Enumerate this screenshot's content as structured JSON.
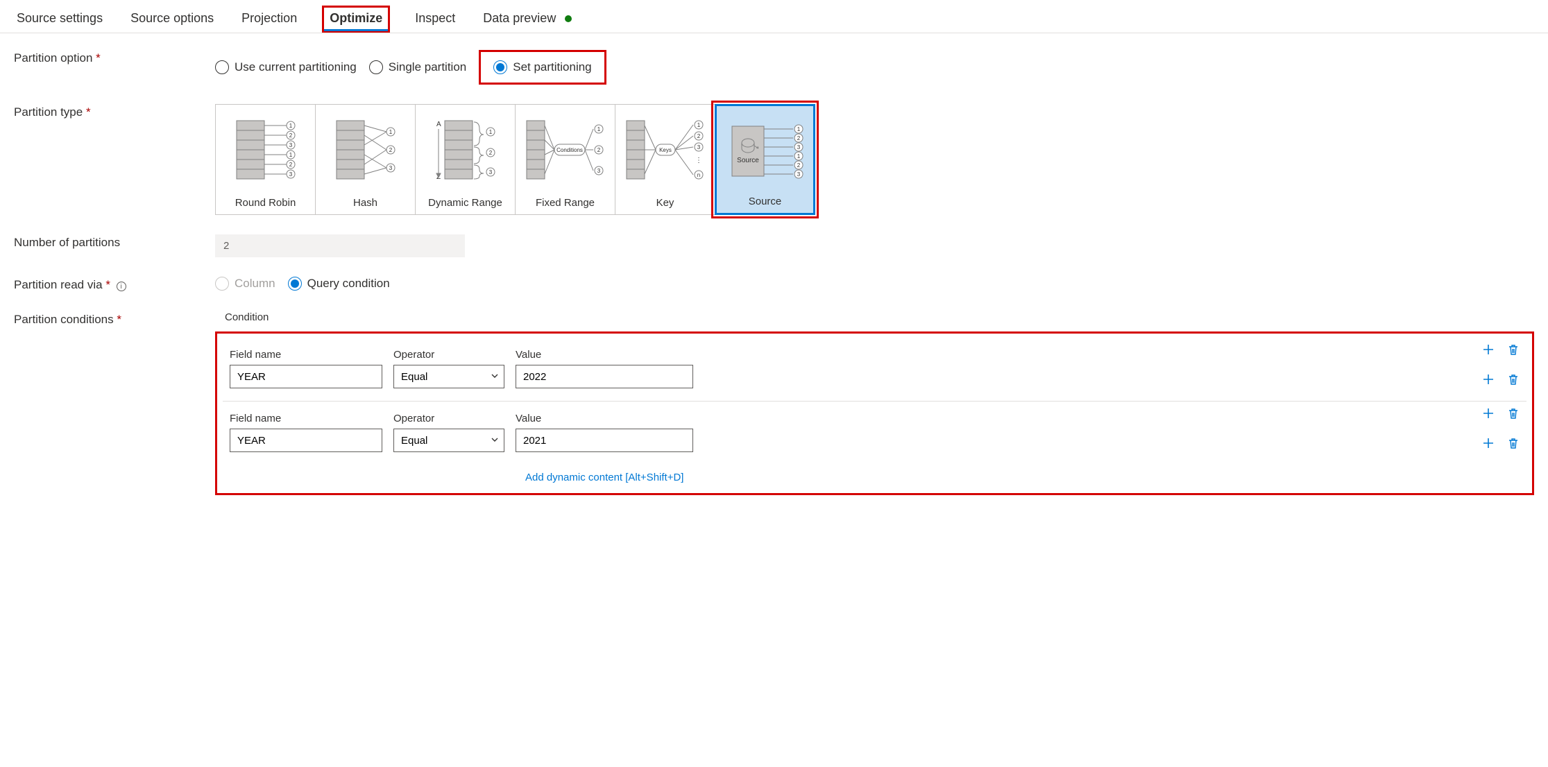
{
  "tabs": {
    "source_settings": "Source settings",
    "source_options": "Source options",
    "projection": "Projection",
    "optimize": "Optimize",
    "inspect": "Inspect",
    "data_preview": "Data preview"
  },
  "labels": {
    "partition_option": "Partition option",
    "partition_type": "Partition type",
    "num_partitions": "Number of partitions",
    "partition_read_via": "Partition read via",
    "partition_conditions": "Partition conditions",
    "condition": "Condition",
    "field_name": "Field name",
    "operator": "Operator",
    "value": "Value",
    "add_dynamic": "Add dynamic content [Alt+Shift+D]"
  },
  "partition_options": {
    "use_current": "Use current partitioning",
    "single": "Single partition",
    "set": "Set partitioning"
  },
  "partition_types": {
    "round_robin": "Round Robin",
    "hash": "Hash",
    "dynamic_range": "Dynamic Range",
    "fixed_range": "Fixed Range",
    "key": "Key",
    "source": "Source"
  },
  "num_partitions_value": "2",
  "read_via": {
    "column": "Column",
    "query_condition": "Query condition"
  },
  "conditions": [
    {
      "field": "YEAR",
      "op": "Equal",
      "value": "2022"
    },
    {
      "field": "YEAR",
      "op": "Equal",
      "value": "2021"
    }
  ]
}
